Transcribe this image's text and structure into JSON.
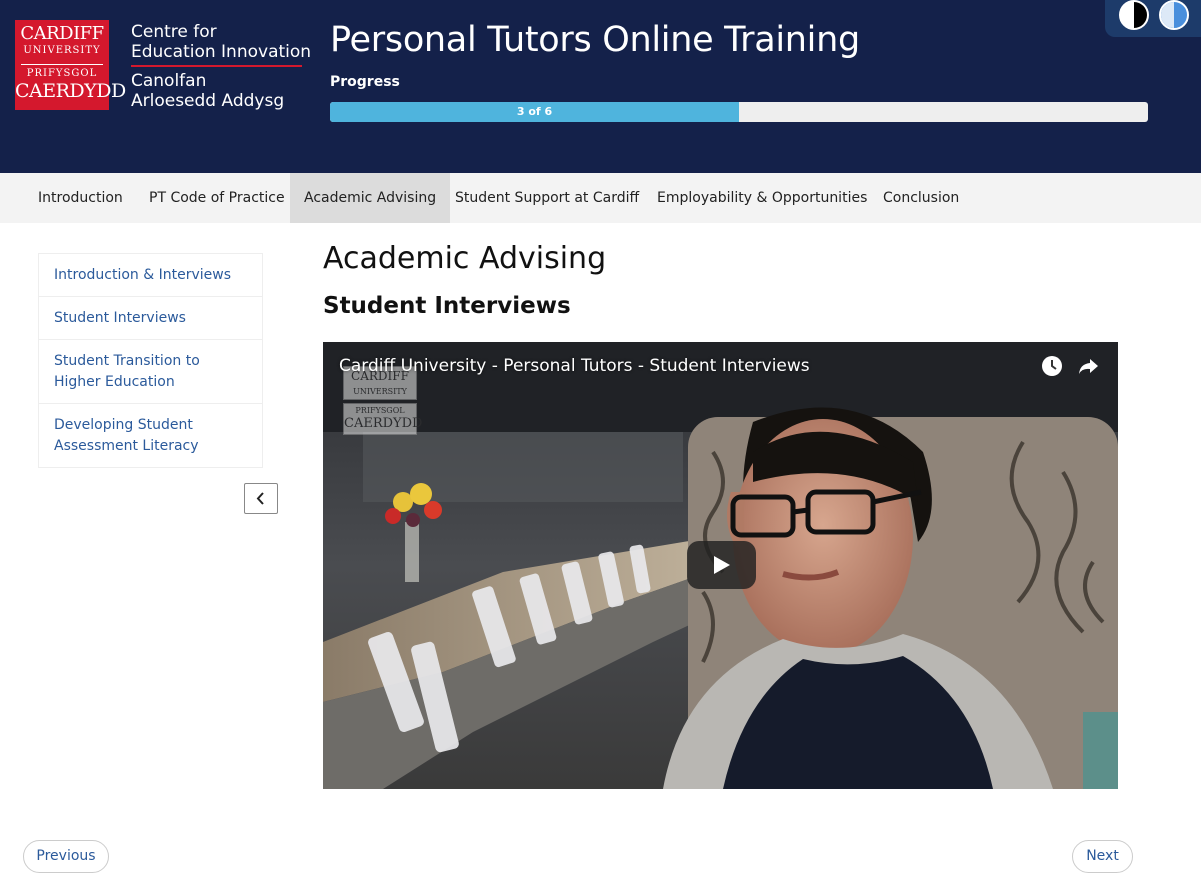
{
  "header": {
    "logo": {
      "line1": "CARDIFF",
      "line2": "UNIVERSITY",
      "line3": "PRIFYSGOL",
      "line4": "CAERDYDD"
    },
    "centre": {
      "line1": "Centre for",
      "line2": "Education Innovation",
      "line3": "Canolfan",
      "line4": "Arloesedd Addysg"
    },
    "title": "Personal Tutors Online Training",
    "progress_label": "Progress",
    "progress_text": "3 of 6",
    "progress_fraction": 0.5,
    "colors": {
      "header_bg": "#14214a",
      "brand_red": "#d4182d",
      "progress_fill": "#4fb4dd"
    }
  },
  "nav": {
    "items": [
      {
        "label": "Introduction",
        "active": false
      },
      {
        "label": "PT Code of Practice",
        "active": false
      },
      {
        "label": "Academic Advising",
        "active": true
      },
      {
        "label": "Student Support at Cardiff",
        "active": false
      },
      {
        "label": "Employability & Opportunities",
        "active": false
      },
      {
        "label": "Conclusion",
        "active": false
      }
    ]
  },
  "sidebar": {
    "items": [
      {
        "label": "Introduction & Interviews"
      },
      {
        "label": "Student Interviews"
      },
      {
        "label": "Student Transition to Higher Education"
      },
      {
        "label": "Developing Student Assessment Literacy"
      }
    ],
    "collapse_icon": "chevron-left-icon"
  },
  "main": {
    "page_title": "Academic Advising",
    "section_title": "Student Interviews",
    "video": {
      "title": "Cardiff University - Personal Tutors - Student Interviews",
      "icons": [
        "clock-icon",
        "share-icon",
        "play-icon"
      ]
    }
  },
  "footer": {
    "previous_label": "Previous",
    "next_label": "Next"
  }
}
